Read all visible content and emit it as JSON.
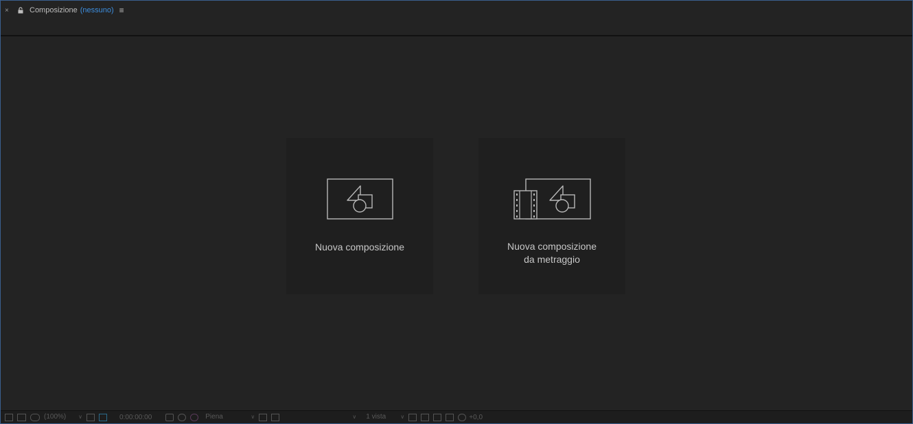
{
  "tab": {
    "close": "×",
    "title": "Composizione",
    "composition": "(nessuno)",
    "menu": "≡"
  },
  "cards": [
    {
      "label": "Nuova composizione"
    },
    {
      "label_line1": "Nuova composizione",
      "label_line2": "da metraggio"
    }
  ],
  "status": {
    "zoom": "(100%)",
    "timecode": "0:00:00:00",
    "resolution": "Piena",
    "views": "1 vista",
    "exposure": "+0,0"
  }
}
